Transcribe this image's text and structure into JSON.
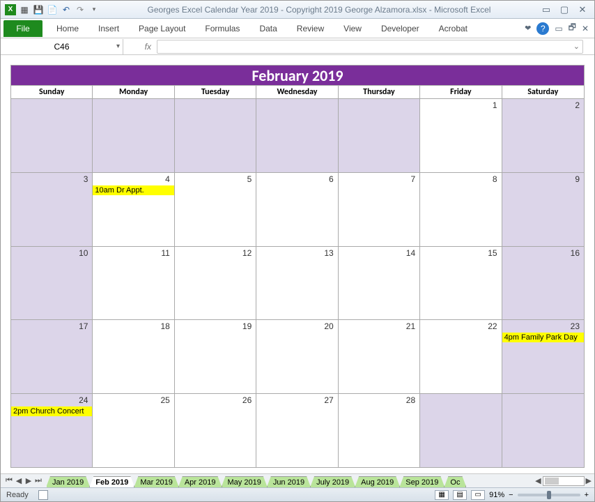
{
  "title": "Georges Excel Calendar Year 2019 - Copyright 2019 George Alzamora.xlsx  -  Microsoft Excel",
  "qat_icons": [
    "excel",
    "customize",
    "save",
    "save-as",
    "undo",
    "redo",
    "dropdown"
  ],
  "ribbon": {
    "file_label": "File",
    "tabs": [
      "Home",
      "Insert",
      "Page Layout",
      "Formulas",
      "Data",
      "Review",
      "View",
      "Developer",
      "Acrobat"
    ]
  },
  "namebox": "C46",
  "formula_value": "",
  "calendar": {
    "title": "February 2019",
    "days_of_week": [
      "Sunday",
      "Monday",
      "Tuesday",
      "Wednesday",
      "Thursday",
      "Friday",
      "Saturday"
    ],
    "weeks": [
      [
        {
          "shade": true
        },
        {
          "shade": true
        },
        {
          "shade": true
        },
        {
          "shade": true
        },
        {
          "shade": true
        },
        {
          "num": "1"
        },
        {
          "num": "2",
          "shade": true
        }
      ],
      [
        {
          "num": "3",
          "shade": true
        },
        {
          "num": "4",
          "event": "10am Dr Appt."
        },
        {
          "num": "5"
        },
        {
          "num": "6"
        },
        {
          "num": "7"
        },
        {
          "num": "8"
        },
        {
          "num": "9",
          "shade": true
        }
      ],
      [
        {
          "num": "10",
          "shade": true
        },
        {
          "num": "11"
        },
        {
          "num": "12"
        },
        {
          "num": "13"
        },
        {
          "num": "14"
        },
        {
          "num": "15"
        },
        {
          "num": "16",
          "shade": true
        }
      ],
      [
        {
          "num": "17",
          "shade": true
        },
        {
          "num": "18"
        },
        {
          "num": "19"
        },
        {
          "num": "20"
        },
        {
          "num": "21"
        },
        {
          "num": "22"
        },
        {
          "num": "23",
          "shade": true,
          "event": "4pm Family Park Day"
        }
      ],
      [
        {
          "num": "24",
          "shade": true,
          "event": "2pm Church Concert"
        },
        {
          "num": "25"
        },
        {
          "num": "26"
        },
        {
          "num": "27"
        },
        {
          "num": "28"
        },
        {
          "shade": true
        },
        {
          "shade": true
        }
      ]
    ]
  },
  "sheet_tabs": [
    "Jan 2019",
    "Feb 2019",
    "Mar 2019",
    "Apr 2019",
    "May 2019",
    "Jun 2019",
    "July 2019",
    "Aug 2019",
    "Sep 2019",
    "Oc"
  ],
  "active_tab_index": 1,
  "status": {
    "ready": "Ready",
    "zoom": "91%"
  },
  "zoom_minus": "−",
  "zoom_plus": "+"
}
